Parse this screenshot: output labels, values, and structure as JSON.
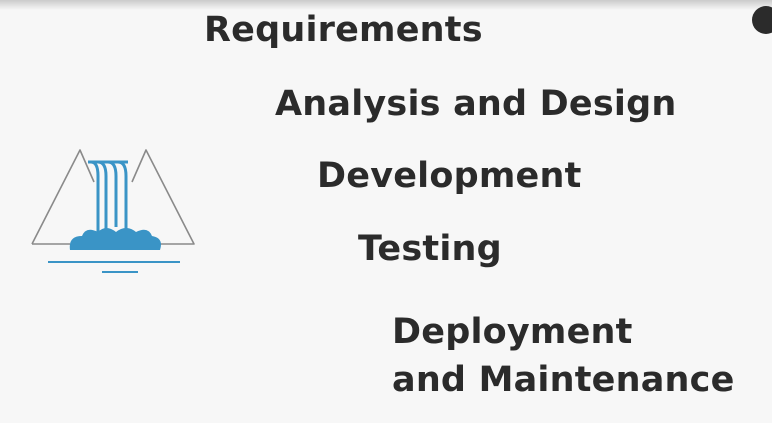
{
  "stages": [
    {
      "lines": [
        "Requirements"
      ]
    },
    {
      "lines": [
        "Analysis and Design"
      ]
    },
    {
      "lines": [
        "Development"
      ]
    },
    {
      "lines": [
        "Testing"
      ]
    },
    {
      "lines": [
        "Deployment",
        "and Maintenance"
      ]
    }
  ],
  "icon": {
    "name": "waterfall-icon",
    "color": "#3a94c6",
    "outline_color": "#8a8a8a"
  },
  "colors": {
    "background": "#f7f7f7",
    "text": "#2b2b2b"
  }
}
